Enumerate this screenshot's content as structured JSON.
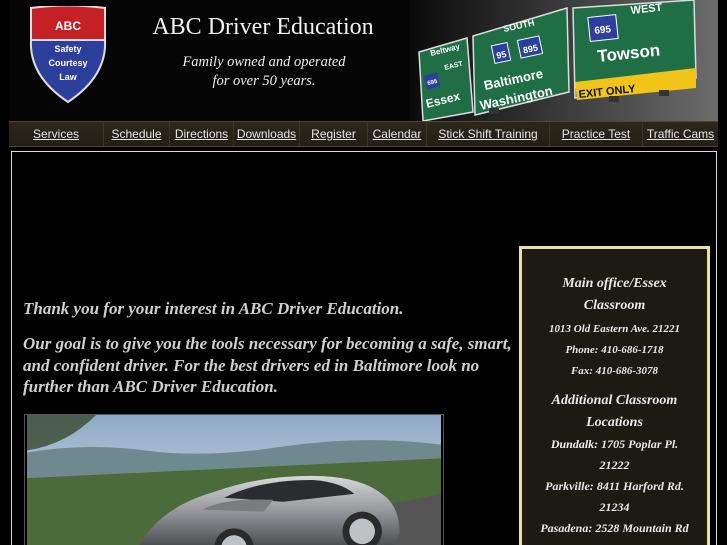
{
  "header": {
    "shield_lines": [
      "ABC",
      "Safety",
      "Courtesy",
      "Law"
    ],
    "title": "ABC Driver Education",
    "tagline_line1": "Family owned and operated",
    "tagline_line2": "for over 50 years.",
    "signs": {
      "beltway": "Beltway",
      "east": "EAST",
      "route_695": "695",
      "route_95": "95",
      "route_895": "895",
      "south": "SOUTH",
      "west": "WEST",
      "essex": "Essex",
      "baltimore": "Baltimore",
      "washington": "Washington",
      "towson": "Towson",
      "exit_only": "EXIT ONLY"
    }
  },
  "nav": {
    "items": [
      "Services",
      "Schedule",
      "Directions",
      "Downloads",
      "Register",
      "Calendar",
      "Stick Shift Training",
      "Practice Test",
      "Traffic Cams"
    ]
  },
  "intro": {
    "thanks": "Thank you for your interest in ABC Driver Education.",
    "goal": "Our goal is to give you the tools necessary for becoming a safe, smart, and confident driver. For the best drivers ed in Baltimore look no further than ABC Driver Education."
  },
  "sidebar": {
    "main_office_heading": "Main office/Essex Classroom",
    "address": "1013 Old Eastern Ave. 21221",
    "phone": "Phone: 410-686-1718",
    "fax": "Fax: 410-686-3078",
    "additional_heading": "Additional Classroom Locations",
    "locations": [
      {
        "name": "Dundalk:",
        "address": "1705 Poplar Pl. 21222"
      },
      {
        "name": "Parkville:",
        "address": "8411 Harford Rd. 21234"
      },
      {
        "name": "Pasadena:",
        "address": "2528 Mountain Rd"
      }
    ]
  },
  "colors": {
    "background": "#000000",
    "nav_bar": "#2a2519",
    "sidebar_border": "#e9e2a2",
    "sign_green": "#1f6e45",
    "shield_blue": "#2c3f9c",
    "shield_red": "#c62027"
  }
}
